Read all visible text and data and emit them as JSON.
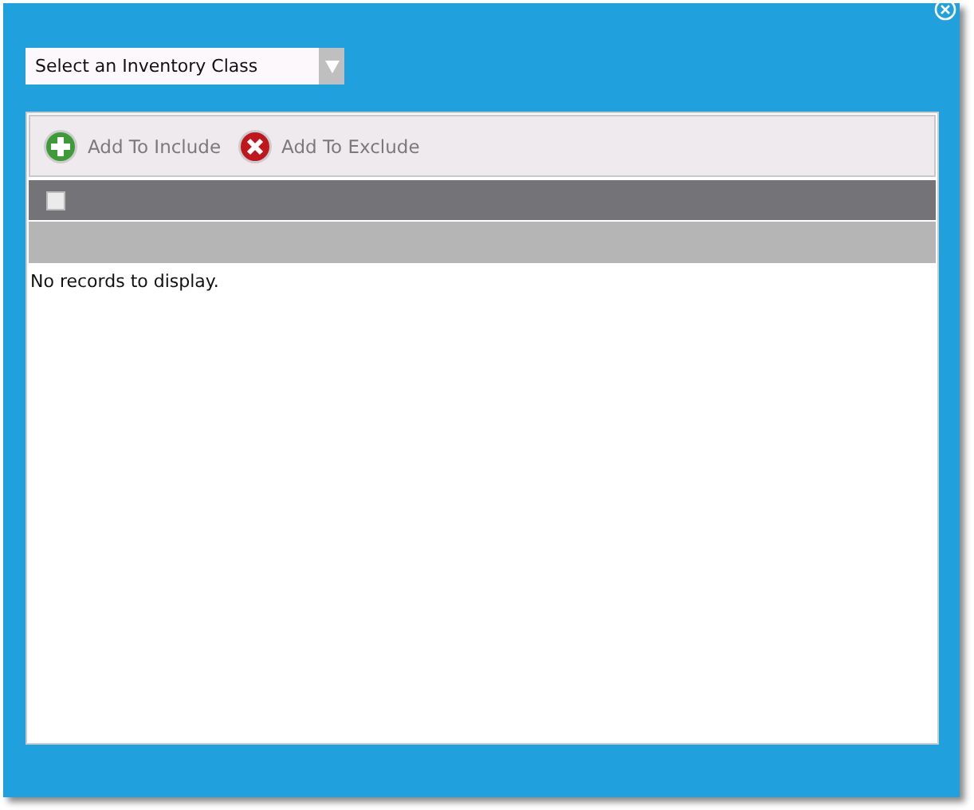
{
  "dropdown": {
    "placeholder": "Select an Inventory Class"
  },
  "toolbar": [
    {
      "kind": "include",
      "label": "Add To Include"
    },
    {
      "kind": "exclude",
      "label": "Add To Exclude"
    }
  ],
  "grid": {
    "header_checkbox": {
      "checked": false
    },
    "empty_message": "No records to display."
  }
}
